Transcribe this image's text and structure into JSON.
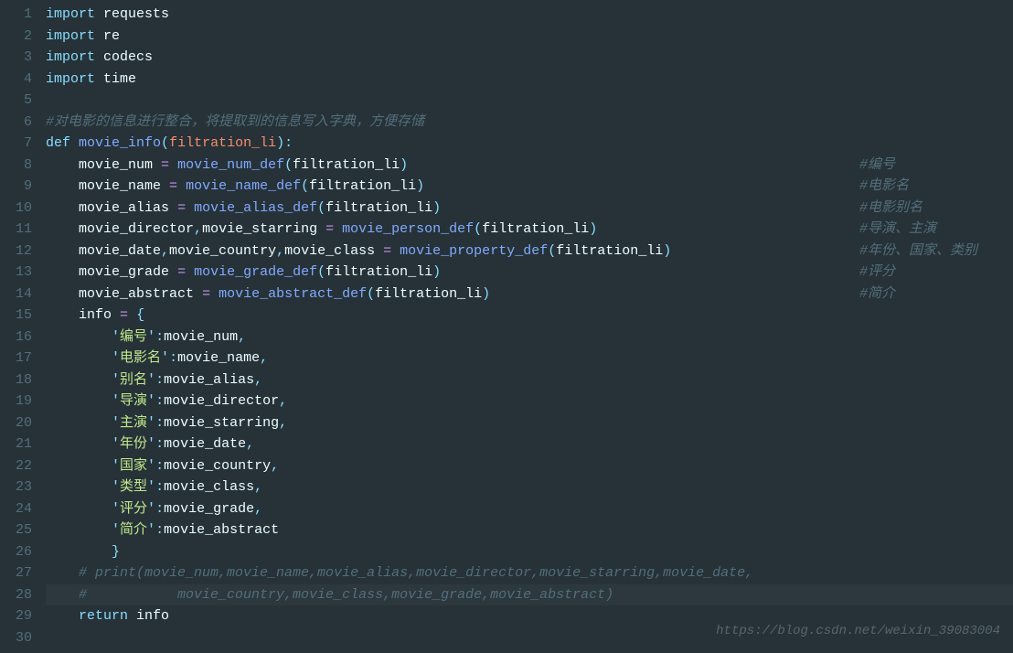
{
  "watermark": "https://blog.csdn.net/weixin_39083004",
  "lines": [
    {
      "num": "1",
      "tokens": [
        {
          "t": "import",
          "c": "kw2"
        },
        {
          "t": " ",
          "c": ""
        },
        {
          "t": "requests",
          "c": "ident"
        }
      ]
    },
    {
      "num": "2",
      "tokens": [
        {
          "t": "import",
          "c": "kw2"
        },
        {
          "t": " ",
          "c": ""
        },
        {
          "t": "re",
          "c": "ident"
        }
      ]
    },
    {
      "num": "3",
      "tokens": [
        {
          "t": "import",
          "c": "kw2"
        },
        {
          "t": " ",
          "c": ""
        },
        {
          "t": "codecs",
          "c": "ident"
        }
      ]
    },
    {
      "num": "4",
      "tokens": [
        {
          "t": "import",
          "c": "kw2"
        },
        {
          "t": " ",
          "c": ""
        },
        {
          "t": "time",
          "c": "ident"
        }
      ]
    },
    {
      "num": "5",
      "tokens": []
    },
    {
      "num": "6",
      "tokens": [
        {
          "t": "#对电影的信息进行整合，将提取到的信息写入字典，方便存储",
          "c": "comment"
        }
      ]
    },
    {
      "num": "7",
      "tokens": [
        {
          "t": "def",
          "c": "kw2"
        },
        {
          "t": " ",
          "c": ""
        },
        {
          "t": "movie_info",
          "c": "fn"
        },
        {
          "t": "(",
          "c": "punct"
        },
        {
          "t": "filtration_li",
          "c": "param"
        },
        {
          "t": ")",
          "c": "punct"
        },
        {
          "t": ":",
          "c": "punct"
        }
      ]
    },
    {
      "num": "8",
      "tokens": [
        {
          "t": "    ",
          "c": ""
        },
        {
          "t": "movie_num",
          "c": "ident"
        },
        {
          "t": " ",
          "c": ""
        },
        {
          "t": "=",
          "c": "op"
        },
        {
          "t": " ",
          "c": ""
        },
        {
          "t": "movie_num_def",
          "c": "fn"
        },
        {
          "t": "(",
          "c": "punct"
        },
        {
          "t": "filtration_li",
          "c": "ident"
        },
        {
          "t": ")",
          "c": "punct"
        }
      ],
      "comment": "#编号",
      "commentCol": 940
    },
    {
      "num": "9",
      "tokens": [
        {
          "t": "    ",
          "c": ""
        },
        {
          "t": "movie_name",
          "c": "ident"
        },
        {
          "t": " ",
          "c": ""
        },
        {
          "t": "=",
          "c": "op"
        },
        {
          "t": " ",
          "c": ""
        },
        {
          "t": "movie_name_def",
          "c": "fn"
        },
        {
          "t": "(",
          "c": "punct"
        },
        {
          "t": "filtration_li",
          "c": "ident"
        },
        {
          "t": ")",
          "c": "punct"
        }
      ],
      "comment": "#电影名",
      "commentCol": 940
    },
    {
      "num": "10",
      "tokens": [
        {
          "t": "    ",
          "c": ""
        },
        {
          "t": "movie_alias",
          "c": "ident"
        },
        {
          "t": " ",
          "c": ""
        },
        {
          "t": "=",
          "c": "op"
        },
        {
          "t": " ",
          "c": ""
        },
        {
          "t": "movie_alias_def",
          "c": "fn"
        },
        {
          "t": "(",
          "c": "punct"
        },
        {
          "t": "filtration_li",
          "c": "ident"
        },
        {
          "t": ")",
          "c": "punct"
        }
      ],
      "comment": "#电影别名",
      "commentCol": 940
    },
    {
      "num": "11",
      "tokens": [
        {
          "t": "    ",
          "c": ""
        },
        {
          "t": "movie_director",
          "c": "ident"
        },
        {
          "t": ",",
          "c": "punct"
        },
        {
          "t": "movie_starring",
          "c": "ident"
        },
        {
          "t": " ",
          "c": ""
        },
        {
          "t": "=",
          "c": "op"
        },
        {
          "t": " ",
          "c": ""
        },
        {
          "t": "movie_person_def",
          "c": "fn"
        },
        {
          "t": "(",
          "c": "punct"
        },
        {
          "t": "filtration_li",
          "c": "ident"
        },
        {
          "t": ")",
          "c": "punct"
        }
      ],
      "comment": "#导演、主演",
      "commentCol": 940
    },
    {
      "num": "12",
      "tokens": [
        {
          "t": "    ",
          "c": ""
        },
        {
          "t": "movie_date",
          "c": "ident"
        },
        {
          "t": ",",
          "c": "punct"
        },
        {
          "t": "movie_country",
          "c": "ident"
        },
        {
          "t": ",",
          "c": "punct"
        },
        {
          "t": "movie_class",
          "c": "ident"
        },
        {
          "t": " ",
          "c": ""
        },
        {
          "t": "=",
          "c": "op"
        },
        {
          "t": " ",
          "c": ""
        },
        {
          "t": "movie_property_def",
          "c": "fn"
        },
        {
          "t": "(",
          "c": "punct"
        },
        {
          "t": "filtration_li",
          "c": "ident"
        },
        {
          "t": ")",
          "c": "punct"
        }
      ],
      "comment": "#年份、国家、类别",
      "commentCol": 940
    },
    {
      "num": "13",
      "tokens": [
        {
          "t": "    ",
          "c": ""
        },
        {
          "t": "movie_grade",
          "c": "ident"
        },
        {
          "t": " ",
          "c": ""
        },
        {
          "t": "=",
          "c": "op"
        },
        {
          "t": " ",
          "c": ""
        },
        {
          "t": "movie_grade_def",
          "c": "fn"
        },
        {
          "t": "(",
          "c": "punct"
        },
        {
          "t": "filtration_li",
          "c": "ident"
        },
        {
          "t": ")",
          "c": "punct"
        }
      ],
      "comment": "#评分",
      "commentCol": 940
    },
    {
      "num": "14",
      "tokens": [
        {
          "t": "    ",
          "c": ""
        },
        {
          "t": "movie_abstract",
          "c": "ident"
        },
        {
          "t": " ",
          "c": ""
        },
        {
          "t": "=",
          "c": "op"
        },
        {
          "t": " ",
          "c": ""
        },
        {
          "t": "movie_abstract_def",
          "c": "fn"
        },
        {
          "t": "(",
          "c": "punct"
        },
        {
          "t": "filtration_li",
          "c": "ident"
        },
        {
          "t": ")",
          "c": "punct"
        }
      ],
      "comment": "#简介",
      "commentCol": 940
    },
    {
      "num": "15",
      "tokens": [
        {
          "t": "    ",
          "c": ""
        },
        {
          "t": "info",
          "c": "ident"
        },
        {
          "t": " ",
          "c": ""
        },
        {
          "t": "=",
          "c": "op"
        },
        {
          "t": " ",
          "c": ""
        },
        {
          "t": "{",
          "c": "punct"
        }
      ]
    },
    {
      "num": "16",
      "tokens": [
        {
          "t": "        ",
          "c": ""
        },
        {
          "t": "'",
          "c": "punct"
        },
        {
          "t": "编号",
          "c": "str"
        },
        {
          "t": "'",
          "c": "punct"
        },
        {
          "t": ":",
          "c": "punct"
        },
        {
          "t": "movie_num",
          "c": "ident"
        },
        {
          "t": ",",
          "c": "punct"
        }
      ]
    },
    {
      "num": "17",
      "tokens": [
        {
          "t": "        ",
          "c": ""
        },
        {
          "t": "'",
          "c": "punct"
        },
        {
          "t": "电影名",
          "c": "str"
        },
        {
          "t": "'",
          "c": "punct"
        },
        {
          "t": ":",
          "c": "punct"
        },
        {
          "t": "movie_name",
          "c": "ident"
        },
        {
          "t": ",",
          "c": "punct"
        }
      ]
    },
    {
      "num": "18",
      "tokens": [
        {
          "t": "        ",
          "c": ""
        },
        {
          "t": "'",
          "c": "punct"
        },
        {
          "t": "别名",
          "c": "str"
        },
        {
          "t": "'",
          "c": "punct"
        },
        {
          "t": ":",
          "c": "punct"
        },
        {
          "t": "movie_alias",
          "c": "ident"
        },
        {
          "t": ",",
          "c": "punct"
        }
      ]
    },
    {
      "num": "19",
      "tokens": [
        {
          "t": "        ",
          "c": ""
        },
        {
          "t": "'",
          "c": "punct"
        },
        {
          "t": "导演",
          "c": "str"
        },
        {
          "t": "'",
          "c": "punct"
        },
        {
          "t": ":",
          "c": "punct"
        },
        {
          "t": "movie_director",
          "c": "ident"
        },
        {
          "t": ",",
          "c": "punct"
        }
      ]
    },
    {
      "num": "20",
      "tokens": [
        {
          "t": "        ",
          "c": ""
        },
        {
          "t": "'",
          "c": "punct"
        },
        {
          "t": "主演",
          "c": "str"
        },
        {
          "t": "'",
          "c": "punct"
        },
        {
          "t": ":",
          "c": "punct"
        },
        {
          "t": "movie_starring",
          "c": "ident"
        },
        {
          "t": ",",
          "c": "punct"
        }
      ]
    },
    {
      "num": "21",
      "tokens": [
        {
          "t": "        ",
          "c": ""
        },
        {
          "t": "'",
          "c": "punct"
        },
        {
          "t": "年份",
          "c": "str"
        },
        {
          "t": "'",
          "c": "punct"
        },
        {
          "t": ":",
          "c": "punct"
        },
        {
          "t": "movie_date",
          "c": "ident"
        },
        {
          "t": ",",
          "c": "punct"
        }
      ]
    },
    {
      "num": "22",
      "tokens": [
        {
          "t": "        ",
          "c": ""
        },
        {
          "t": "'",
          "c": "punct"
        },
        {
          "t": "国家",
          "c": "str"
        },
        {
          "t": "'",
          "c": "punct"
        },
        {
          "t": ":",
          "c": "punct"
        },
        {
          "t": "movie_country",
          "c": "ident"
        },
        {
          "t": ",",
          "c": "punct"
        }
      ]
    },
    {
      "num": "23",
      "tokens": [
        {
          "t": "        ",
          "c": ""
        },
        {
          "t": "'",
          "c": "punct"
        },
        {
          "t": "类型",
          "c": "str"
        },
        {
          "t": "'",
          "c": "punct"
        },
        {
          "t": ":",
          "c": "punct"
        },
        {
          "t": "movie_class",
          "c": "ident"
        },
        {
          "t": ",",
          "c": "punct"
        }
      ]
    },
    {
      "num": "24",
      "tokens": [
        {
          "t": "        ",
          "c": ""
        },
        {
          "t": "'",
          "c": "punct"
        },
        {
          "t": "评分",
          "c": "str"
        },
        {
          "t": "'",
          "c": "punct"
        },
        {
          "t": ":",
          "c": "punct"
        },
        {
          "t": "movie_grade",
          "c": "ident"
        },
        {
          "t": ",",
          "c": "punct"
        }
      ]
    },
    {
      "num": "25",
      "tokens": [
        {
          "t": "        ",
          "c": ""
        },
        {
          "t": "'",
          "c": "punct"
        },
        {
          "t": "简介",
          "c": "str"
        },
        {
          "t": "'",
          "c": "punct"
        },
        {
          "t": ":",
          "c": "punct"
        },
        {
          "t": "movie_abstract",
          "c": "ident"
        }
      ]
    },
    {
      "num": "26",
      "tokens": [
        {
          "t": "        ",
          "c": ""
        },
        {
          "t": "}",
          "c": "punct"
        }
      ]
    },
    {
      "num": "27",
      "tokens": [
        {
          "t": "    ",
          "c": ""
        },
        {
          "t": "# print(movie_num,movie_name,movie_alias,movie_director,movie_starring,movie_date,",
          "c": "comment"
        }
      ]
    },
    {
      "num": "28",
      "tokens": [
        {
          "t": "    ",
          "c": ""
        },
        {
          "t": "#           movie_country,movie_class,movie_grade,movie_abstract)",
          "c": "comment"
        }
      ],
      "highlight": true
    },
    {
      "num": "29",
      "tokens": [
        {
          "t": "    ",
          "c": ""
        },
        {
          "t": "return",
          "c": "kw2"
        },
        {
          "t": " ",
          "c": ""
        },
        {
          "t": "info",
          "c": "ident"
        }
      ]
    },
    {
      "num": "30",
      "tokens": []
    }
  ]
}
